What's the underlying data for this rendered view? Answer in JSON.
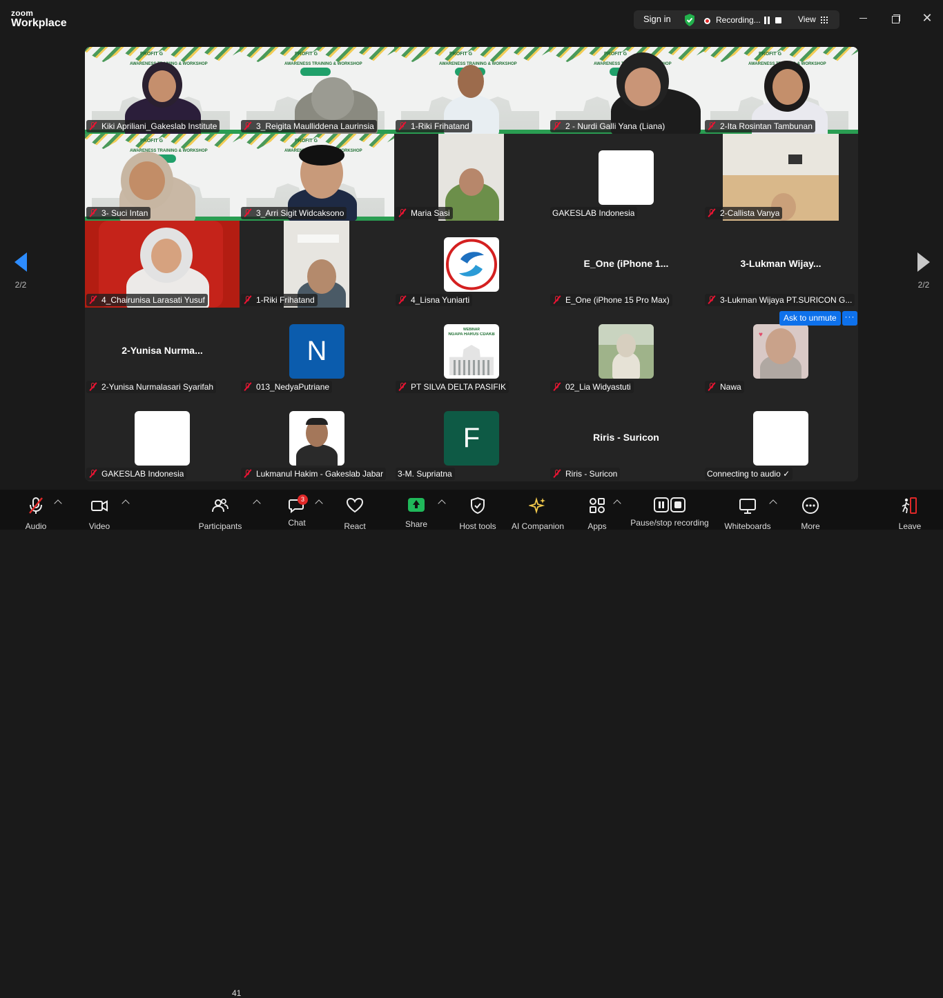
{
  "app": {
    "logo_line1": "zoom",
    "logo_line2": "Workplace"
  },
  "header": {
    "sign_in": "Sign in",
    "recording": "Recording...",
    "view": "View"
  },
  "pagination": {
    "left_page": "2/2",
    "right_page": "2/2"
  },
  "participants": [
    {
      "name": "Kiki Apriliani_Gakeslab Institute",
      "muted": true
    },
    {
      "name": "3_Reigita Maulliddena Laurinsia",
      "muted": true
    },
    {
      "name": "1-Riki Frihatand",
      "muted": true
    },
    {
      "name": "2 - Nurdi Galli Yana (Liana)",
      "muted": true
    },
    {
      "name": "2-Ita Rosintan Tambunan",
      "muted": true
    },
    {
      "name": "3- Suci Intan",
      "muted": true
    },
    {
      "name": "3_Arri Sigit Widcaksono",
      "muted": true
    },
    {
      "name": "Maria Sasi",
      "muted": true
    },
    {
      "name": "GAKESLAB Indonesia",
      "muted": false
    },
    {
      "name": "2-Callista Vanya",
      "muted": true
    },
    {
      "name": "4_Chairunisa Larasati Yusuf",
      "muted": true
    },
    {
      "name": "1-Riki Frihatand",
      "muted": true
    },
    {
      "name": "4_Lisna Yuniarti",
      "muted": true
    },
    {
      "name": "E_One (iPhone 15 Pro Max)",
      "muted": true,
      "display": "E_One  (iPhone 1..."
    },
    {
      "name": "3-Lukman Wijaya PT.SURICON G...",
      "muted": true,
      "display": "3-Lukman  Wijay..."
    },
    {
      "name": "2-Yunisa Nurmalasari Syarifah",
      "muted": true,
      "display": "2-Yunisa  Nurma..."
    },
    {
      "name": "013_NedyaPutriane",
      "muted": true,
      "avatar_letter": "N"
    },
    {
      "name": "PT SILVA DELTA PASIFIK",
      "muted": true,
      "avatar_text": "NGAPA HARUS CDAKB",
      "avatar_top": "WEBINAR"
    },
    {
      "name": "02_Lia Widyastuti",
      "muted": true
    },
    {
      "name": "Nawa",
      "muted": true
    },
    {
      "name": "GAKESLAB Indonesia",
      "muted": true
    },
    {
      "name": "Lukmanul Hakim - Gakeslab Jabar",
      "muted": true
    },
    {
      "name": "3-M. Supriatna",
      "muted": false,
      "avatar_letter": "F"
    },
    {
      "name": "Riris - Suricon",
      "muted": true,
      "display": "Riris - Suricon"
    },
    {
      "name": "Connecting to audio ✓",
      "muted": false
    }
  ],
  "banner": {
    "logo": "PROFIT G",
    "subtitle": "AWARENESS TRAINING & WORKSHOP",
    "pill": "CDAKB"
  },
  "hover_actions": {
    "ask_unmute": "Ask to unmute",
    "more": "···"
  },
  "toolbar": {
    "audio": "Audio",
    "video": "Video",
    "participants": "Participants",
    "participants_count": "41",
    "chat": "Chat",
    "chat_badge": "3",
    "react": "React",
    "share": "Share",
    "host_tools": "Host tools",
    "ai_companion": "AI Companion",
    "apps": "Apps",
    "pause_stop": "Pause/stop recording",
    "whiteboards": "Whiteboards",
    "more": "More",
    "leave": "Leave"
  },
  "colors": {
    "accent": "#2d8cff",
    "record": "#e02828",
    "share": "#20b85a",
    "leave": "#e02828"
  }
}
